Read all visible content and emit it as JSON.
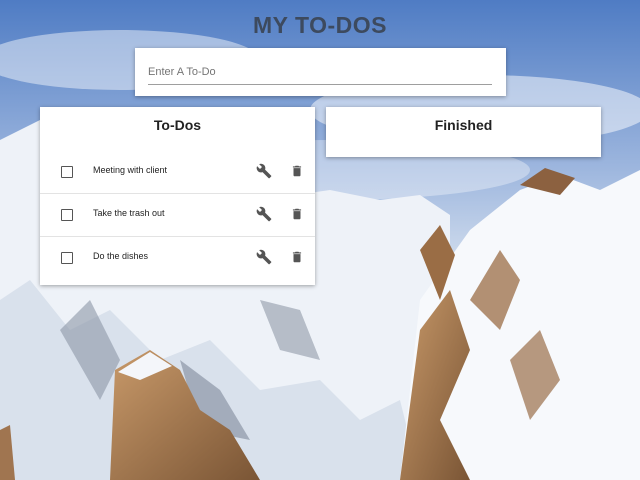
{
  "header": {
    "title": "MY TO-DOS"
  },
  "input": {
    "placeholder": "Enter A To-Do"
  },
  "todos_panel": {
    "title": "To-Dos",
    "items": [
      {
        "label": "Meeting with client",
        "checked": false
      },
      {
        "label": "Take the trash out",
        "checked": false
      },
      {
        "label": "Do the dishes",
        "checked": false
      }
    ]
  },
  "finished_panel": {
    "title": "Finished",
    "items": []
  },
  "icons": {
    "edit": "wrench-icon",
    "delete": "trash-icon",
    "check": "checkbox"
  },
  "colors": {
    "title": "#3d4a5e",
    "card": "#ffffff",
    "icon": "#555555"
  }
}
